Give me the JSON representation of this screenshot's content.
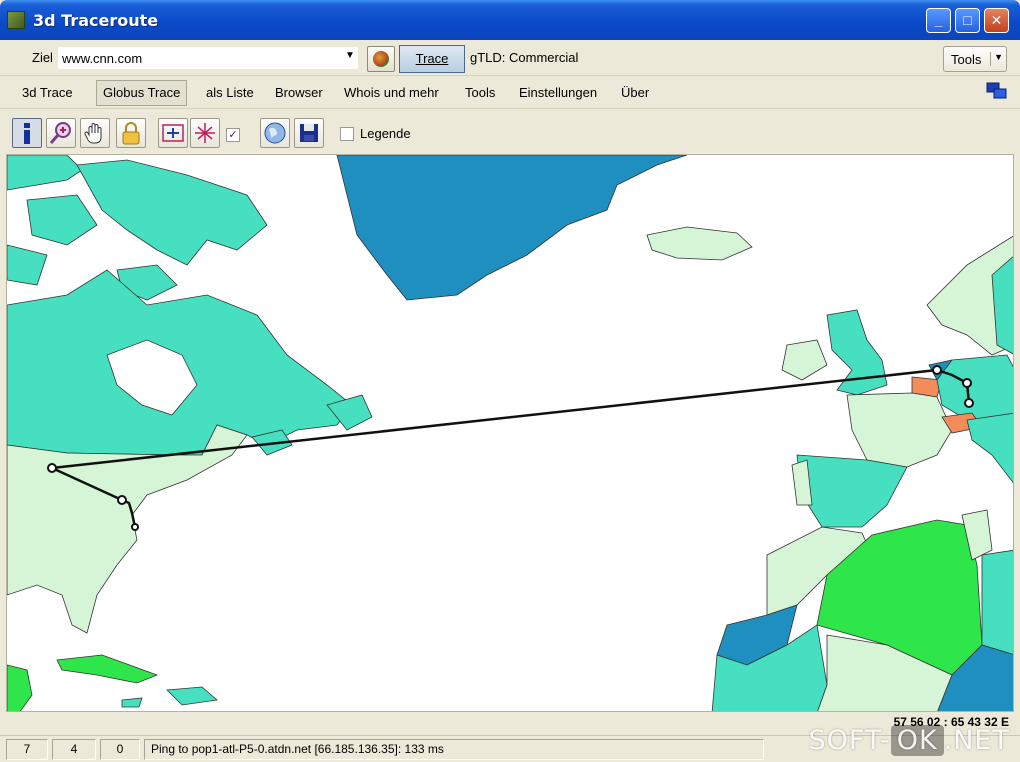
{
  "window": {
    "title": "3d Traceroute",
    "minimize_icon": "minimize-icon",
    "maximize_icon": "maximize-icon",
    "close_icon": "close-icon"
  },
  "address_bar": {
    "label": "Ziel",
    "value": "www.cnn.com",
    "trace_label": "Trace",
    "gtld_text": "gTLD: Commercial",
    "tools_label": "Tools"
  },
  "menu": {
    "items": [
      "3d Trace",
      "Globus Trace",
      "als Liste",
      "Browser",
      "Whois und mehr",
      "Tools",
      "Einstellungen",
      "Über"
    ],
    "active": "Globus Trace"
  },
  "toolbar": {
    "buttons": [
      "info-icon",
      "zoom-in-icon",
      "pan-hand-icon",
      "lock-icon",
      "fit-view-icon",
      "expand-icon",
      "check-icon",
      "globe-icon",
      "save-icon"
    ],
    "legend_label": "Legende",
    "legend_checked": false
  },
  "map": {
    "colors": {
      "ocean": "#ffffff",
      "land_light": "#d6f5d6",
      "land_cyan": "#46e0c0",
      "land_blue": "#1f8fbf",
      "land_green": "#2ee64a",
      "highlight": "#f28c5a",
      "route_line": "#111111"
    }
  },
  "coordinates": "57 56 02 : 65 43 32 E",
  "status": {
    "cells": [
      "7",
      "4",
      "0"
    ],
    "message": "Ping to pop1-atl-P5-0.atdn.net [66.185.136.35]: 133 ms"
  },
  "watermark": {
    "left": "SOFT-",
    "ok": "OK",
    "right": ".NET"
  }
}
